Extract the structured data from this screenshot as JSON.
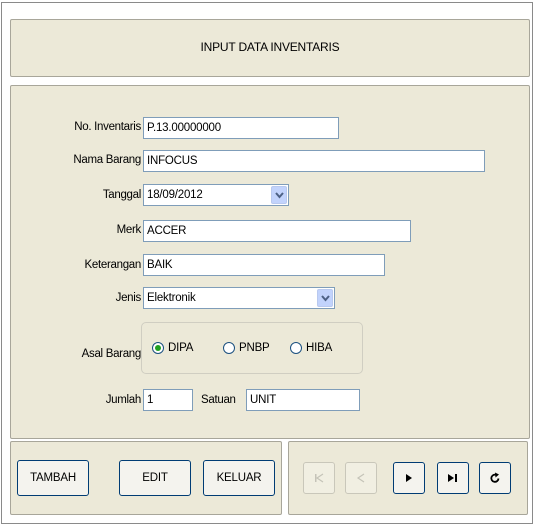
{
  "header": {
    "title": "INPUT DATA INVENTARIS"
  },
  "form": {
    "no_inventaris_label": "No. Inventaris",
    "no_inventaris_value": "P.13.00000000",
    "nama_barang_label": "Nama Barang",
    "nama_barang_value": "INFOCUS",
    "tanggal_label": "Tanggal",
    "tanggal_value": "18/09/2012",
    "merk_label": "Merk",
    "merk_value": "ACCER",
    "keterangan_label": "Keterangan",
    "keterangan_value": "BAIK",
    "jenis_label": "Jenis",
    "jenis_value": "Elektronik",
    "asal_barang_label": "Asal Barang",
    "asal_options": [
      {
        "label": "DIPA",
        "selected": true
      },
      {
        "label": "PNBP",
        "selected": false
      },
      {
        "label": "HIBA",
        "selected": false
      }
    ],
    "jumlah_label": "Jumlah",
    "jumlah_value": "1",
    "satuan_label": "Satuan",
    "satuan_value": "UNIT"
  },
  "buttons": {
    "tambah": "TAMBAH",
    "edit": "EDIT",
    "keluar": "KELUAR"
  },
  "navigation": {
    "first": {
      "icon": "first-record-icon",
      "enabled": false
    },
    "prev": {
      "icon": "previous-record-icon",
      "enabled": false
    },
    "next": {
      "icon": "next-record-icon",
      "enabled": true
    },
    "last": {
      "icon": "last-record-icon",
      "enabled": true
    },
    "refresh": {
      "icon": "refresh-icon",
      "enabled": true
    }
  },
  "colors": {
    "panel": "#ece9d8",
    "field_border": "#7f9db9",
    "radio_selected": "#21a121",
    "button_border": "#003c74"
  }
}
